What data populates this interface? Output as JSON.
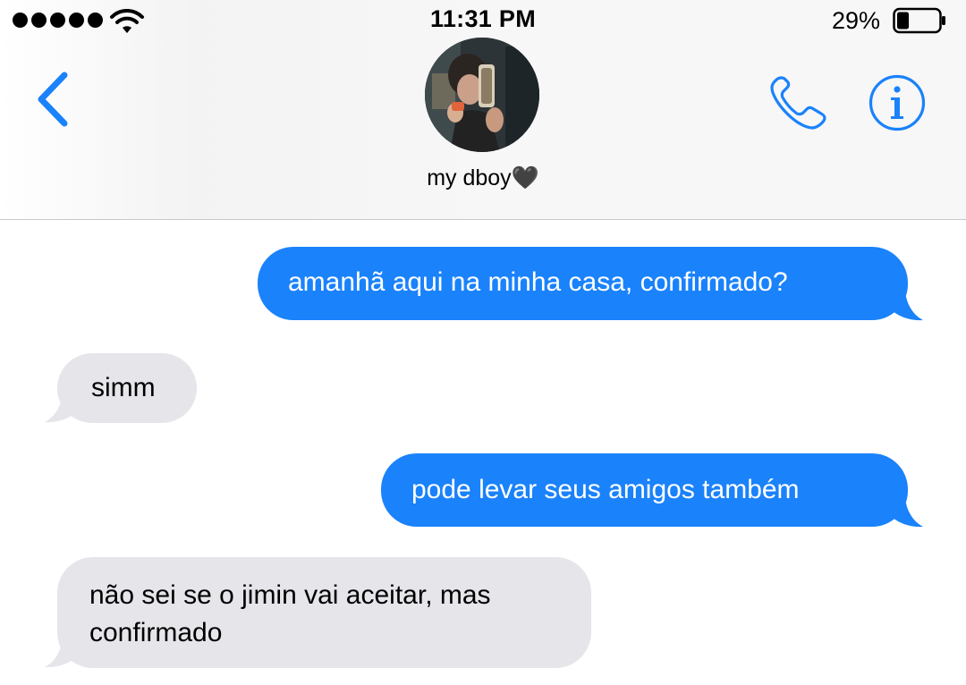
{
  "status_bar": {
    "time": "11:31 PM",
    "battery_percent": "29%",
    "battery_level": 0.29,
    "signal_dots": 5
  },
  "header": {
    "contact_name": "my dboy🖤",
    "icons": [
      "back-chevron-icon",
      "phone-icon",
      "info-icon"
    ],
    "accent_color": "#1a82fb"
  },
  "messages": [
    {
      "direction": "outgoing",
      "text": "amanhã aqui na minha casa, confirmado?"
    },
    {
      "direction": "incoming",
      "text": "simm"
    },
    {
      "direction": "outgoing",
      "text": "pode levar seus amigos também"
    },
    {
      "direction": "incoming",
      "text": "não sei se o jimin vai aceitar, mas confirmado"
    }
  ],
  "colors": {
    "outgoing_bubble": "#1a82fb",
    "incoming_bubble": "#e5e5ea"
  }
}
